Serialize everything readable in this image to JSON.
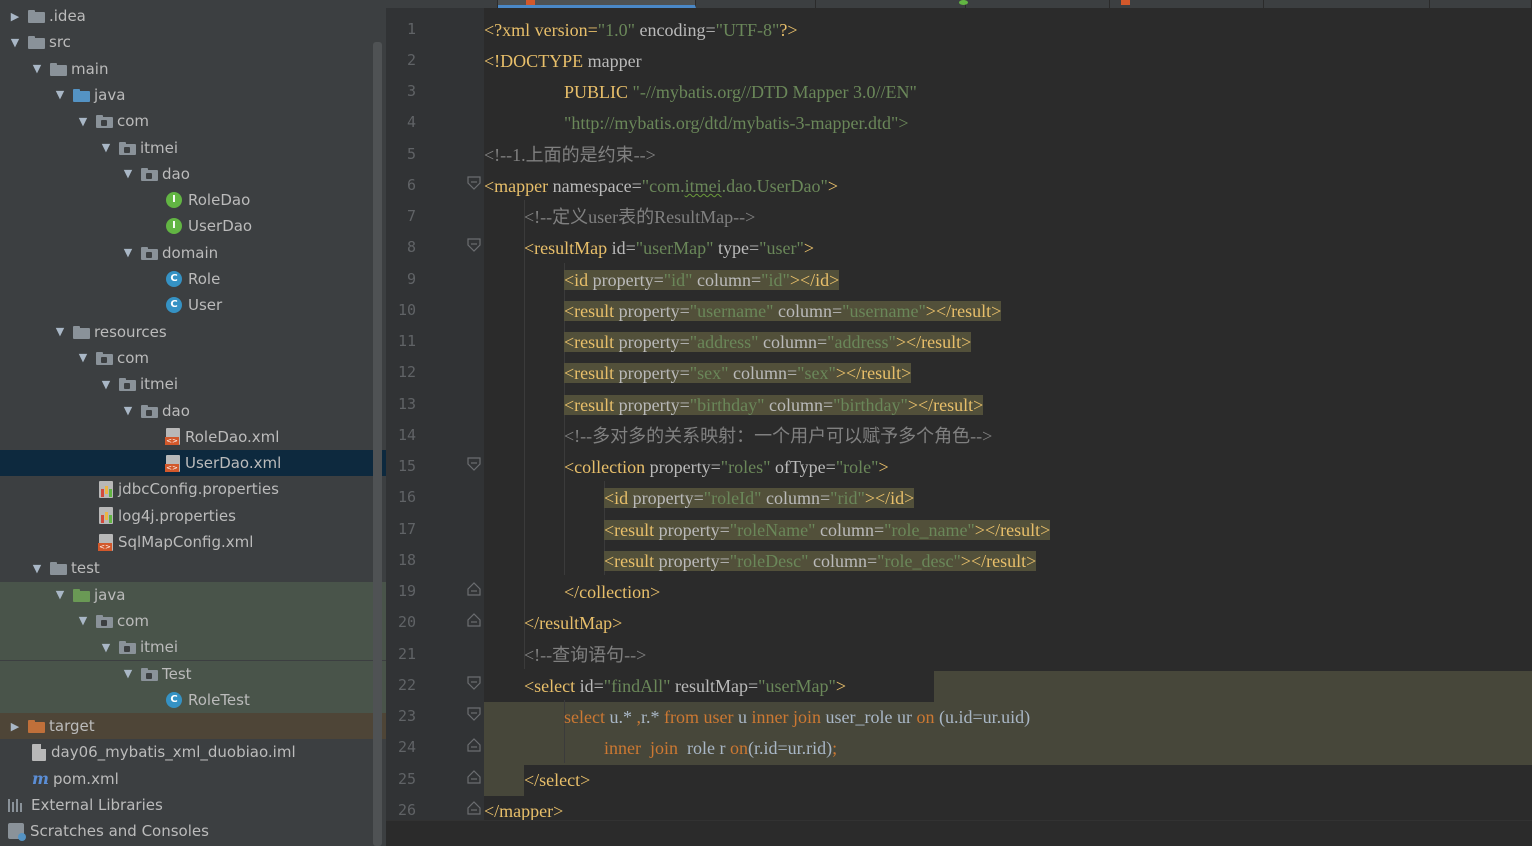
{
  "project_tree": {
    "rows": [
      {
        "label": ".idea",
        "arrow": "right",
        "icon": "folder-icon"
      },
      {
        "label": "src",
        "arrow": "down",
        "icon": "folder-icon"
      },
      {
        "label": "main",
        "arrow": "down",
        "icon": "folder-icon"
      },
      {
        "label": "java",
        "arrow": "down",
        "icon": "source-root-folder-icon"
      },
      {
        "label": "com",
        "arrow": "down",
        "icon": "package-icon"
      },
      {
        "label": "itmei",
        "arrow": "down",
        "icon": "package-icon"
      },
      {
        "label": "dao",
        "arrow": "down",
        "icon": "package-icon"
      },
      {
        "label": "RoleDao",
        "arrow": "none",
        "icon": "interface-icon"
      },
      {
        "label": "UserDao",
        "arrow": "none",
        "icon": "interface-icon"
      },
      {
        "label": "domain",
        "arrow": "down",
        "icon": "package-icon"
      },
      {
        "label": "Role",
        "arrow": "none",
        "icon": "class-icon"
      },
      {
        "label": "User",
        "arrow": "none",
        "icon": "class-icon"
      },
      {
        "label": "resources",
        "arrow": "down",
        "icon": "resources-folder-icon"
      },
      {
        "label": "com",
        "arrow": "down",
        "icon": "package-icon"
      },
      {
        "label": "itmei",
        "arrow": "down",
        "icon": "package-icon"
      },
      {
        "label": "dao",
        "arrow": "down",
        "icon": "package-icon"
      },
      {
        "label": "RoleDao.xml",
        "arrow": "none",
        "icon": "xml-file-icon"
      },
      {
        "label": "UserDao.xml",
        "arrow": "none",
        "icon": "xml-file-icon",
        "selected": true
      },
      {
        "label": "jdbcConfig.properties",
        "arrow": "none",
        "icon": "properties-file-icon"
      },
      {
        "label": "log4j.properties",
        "arrow": "none",
        "icon": "properties-file-icon"
      },
      {
        "label": "SqlMapConfig.xml",
        "arrow": "none",
        "icon": "xml-file-icon"
      },
      {
        "label": "test",
        "arrow": "down",
        "icon": "folder-icon"
      },
      {
        "label": "java",
        "arrow": "down",
        "icon": "test-root-folder-icon"
      },
      {
        "label": "com",
        "arrow": "down",
        "icon": "package-icon"
      },
      {
        "label": "itmei",
        "arrow": "down",
        "icon": "package-icon"
      },
      {
        "label": "Test",
        "arrow": "down",
        "icon": "package-icon"
      },
      {
        "label": "RoleTest",
        "arrow": "none",
        "icon": "class-icon"
      },
      {
        "label": "target",
        "arrow": "right",
        "icon": "excluded-folder-icon"
      },
      {
        "label": "day06_mybatis_xml_duobiao.iml",
        "arrow": "none",
        "icon": "iml-file-icon"
      },
      {
        "label": "pom.xml",
        "arrow": "none",
        "icon": "maven-icon"
      },
      {
        "label": "External Libraries",
        "arrow": "none",
        "icon": "external-libraries-icon"
      },
      {
        "label": "Scratches and Consoles",
        "arrow": "none",
        "icon": "scratches-icon"
      }
    ]
  },
  "editor": {
    "line_numbers": [
      "1",
      "2",
      "3",
      "4",
      "5",
      "6",
      "7",
      "8",
      "9",
      "10",
      "11",
      "12",
      "13",
      "14",
      "15",
      "16",
      "17",
      "18",
      "19",
      "20",
      "21",
      "22",
      "23",
      "24",
      "25",
      "26"
    ],
    "lines": {
      "l1": {
        "a": "<?xml version=",
        "b": "\"1.0\"",
        "c": " encoding=",
        "d": "\"UTF-8\"",
        "e": "?>"
      },
      "l2": {
        "a": "<!DOCTYPE ",
        "b": "mapper"
      },
      "l3": {
        "a": "PUBLIC ",
        "b": "\"-//mybatis.org//DTD Mapper 3.0//EN\""
      },
      "l4": {
        "a": "\"http://mybatis.org/dtd/mybatis-3-mapper.dtd\">"
      },
      "l5": {
        "a": "<!--1.上面的是约束-->"
      },
      "l6": {
        "a": "<mapper ",
        "b": "namespace=",
        "c": "\"com.",
        "d": "itmei",
        "e": ".dao.UserDao\"",
        "f": ">"
      },
      "l7": {
        "a": "<!--定义user表的ResultMap-->"
      },
      "l8": {
        "a": "<resultMap ",
        "b": "id=",
        "c": "\"userMap\"",
        "d": " type=",
        "e": "\"user\"",
        "f": ">"
      },
      "l9": {
        "a": "<id ",
        "b": "property=",
        "c": "\"id\"",
        "d": " column=",
        "e": "\"id\"",
        "f": "></id>"
      },
      "l10": {
        "a": "<result ",
        "b": "property=",
        "c": "\"username\"",
        "d": " column=",
        "e": "\"username\"",
        "f": "></result>"
      },
      "l11": {
        "a": "<result ",
        "b": "property=",
        "c": "\"address\"",
        "d": " column=",
        "e": "\"address\"",
        "f": "></result>"
      },
      "l12": {
        "a": "<result ",
        "b": "property=",
        "c": "\"sex\"",
        "d": " column=",
        "e": "\"sex\"",
        "f": "></result>"
      },
      "l13": {
        "a": "<result ",
        "b": "property=",
        "c": "\"birthday\"",
        "d": " column=",
        "e": "\"birthday\"",
        "f": "></result>"
      },
      "l14": {
        "a": "<!--多对多的关系映射：一个用户可以赋予多个角色-->"
      },
      "l15": {
        "a": "<collection ",
        "b": "property=",
        "c": "\"roles\"",
        "d": " ofType=",
        "e": "\"role\"",
        "f": ">"
      },
      "l16": {
        "a": "<id ",
        "b": "property=",
        "c": "\"roleId\"",
        "d": " column=",
        "e": "\"rid\"",
        "f": "></id>"
      },
      "l17": {
        "a": "<result ",
        "b": "property=",
        "c": "\"roleName\"",
        "d": " column=",
        "e": "\"role_name\"",
        "f": "></result>"
      },
      "l18": {
        "a": "<result ",
        "b": "property=",
        "c": "\"roleDesc\"",
        "d": " column=",
        "e": "\"role_desc\"",
        "f": "></result>"
      },
      "l19": {
        "a": "</collection>"
      },
      "l20": {
        "a": "</resultMap>"
      },
      "l21": {
        "a": "<!--查询语句-->"
      },
      "l22": {
        "a": "<select ",
        "b": "id=",
        "c": "\"findAll\"",
        "d": " resultMap=",
        "e": "\"userMap\"",
        "f": ">"
      },
      "l23": {
        "a": "select ",
        "b": "u.* ",
        "c": ",",
        "d": "r.* ",
        "e": "from ",
        "f": "user ",
        "g": "u ",
        "h": "inner join ",
        "i": "user_role ur ",
        "j": "on ",
        "k": "(u.id=ur.uid)"
      },
      "l24": {
        "a": "inner  join ",
        "b": " role r ",
        "c": "on",
        "d": "(r.id=ur.rid)",
        "e": ";"
      },
      "l25": {
        "a": "</select>"
      },
      "l26": {
        "a": "</mapper>"
      }
    }
  },
  "colors": {
    "tag": "#e8bf6a",
    "attribute": "#bababa",
    "string": "#6a8759",
    "comment": "#808080",
    "keyword": "#cc7832",
    "highlight": "#52503a",
    "selection": "#0d293e"
  }
}
